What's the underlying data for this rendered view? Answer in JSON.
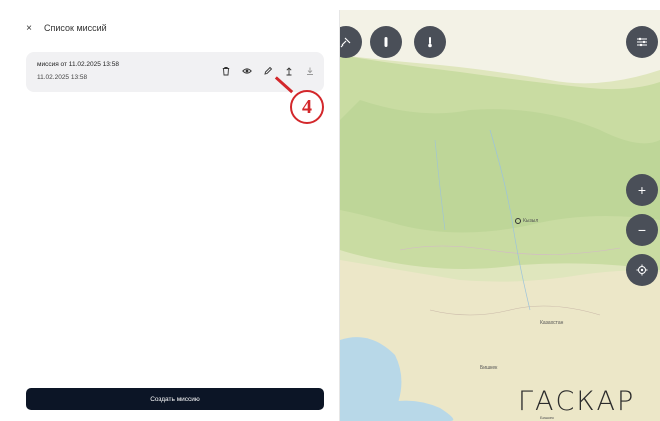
{
  "panel": {
    "close_glyph": "×",
    "title": "Список миссий"
  },
  "missions": [
    {
      "name": "миссия от 11.02.2025 13:58",
      "date": "11.02.2025 13:58",
      "actions": [
        "delete-icon",
        "eye-icon",
        "pencil-icon",
        "upload-icon",
        "download-icon"
      ]
    }
  ],
  "callout": {
    "number": "4",
    "color": "#d3272b"
  },
  "create_button": {
    "label": "Создать миссию",
    "color": "#0c1526"
  },
  "map": {
    "top_buttons": [
      "satellite-icon",
      "drone-icon",
      "thermometer-icon",
      "settings-sliders-icon"
    ],
    "side_buttons": [
      "zoom-in-icon",
      "zoom-out-icon",
      "locate-icon"
    ],
    "zoom_in_label": "+",
    "zoom_out_label": "−",
    "city_labels": [
      "Кызыл",
      "Казахстан",
      "Бишкек"
    ],
    "brand": "ГАСКАР",
    "brand_sub": "Бишкек",
    "button_color": "#4a4f58"
  }
}
